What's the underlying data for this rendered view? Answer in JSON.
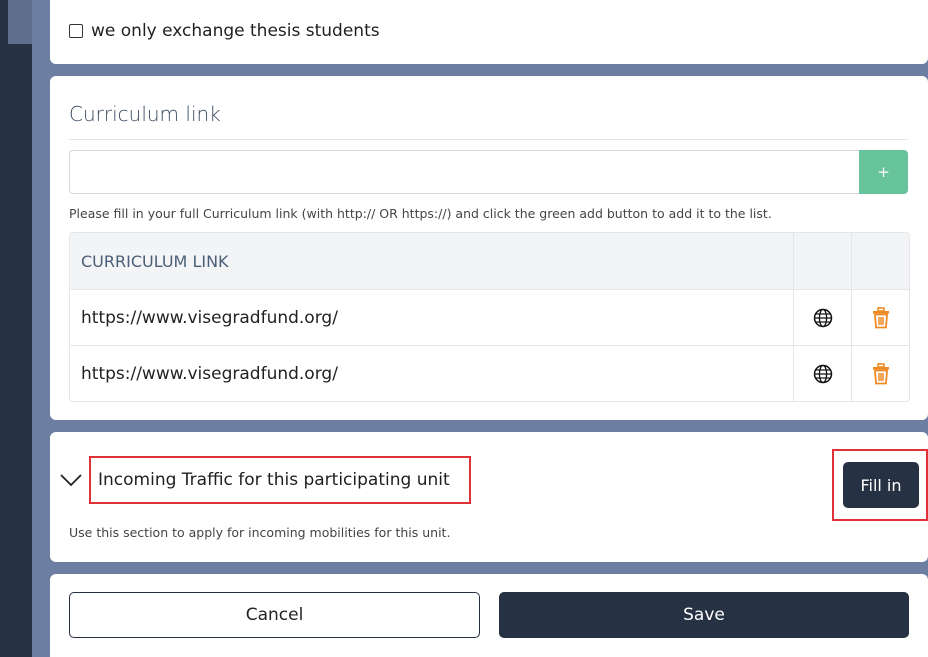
{
  "checkbox": {
    "label": "we only exchange thesis students",
    "checked": false
  },
  "curriculum": {
    "title": "Curriculum link",
    "input_value": "",
    "add_button_label": "+",
    "help_text": "Please fill in your full Curriculum link (with http:// OR https://) and click the green add button to add it to the list.",
    "table": {
      "column_header": "CURRICULUM LINK",
      "rows": [
        {
          "link": "https://www.visegradfund.org/"
        },
        {
          "link": "https://www.visegradfund.org/"
        }
      ]
    }
  },
  "incoming": {
    "title": "Incoming Traffic for this participating unit",
    "fill_in_label": "Fill in",
    "help_text": "Use this section to apply for incoming mobilities for this unit."
  },
  "actions": {
    "cancel_label": "Cancel",
    "save_label": "Save"
  },
  "colors": {
    "navy": "#263243",
    "green": "#66c39a",
    "trash_orange": "#f08a24",
    "highlight_red": "#e0303a",
    "background": "#6c7fa3"
  },
  "icons": {
    "globe": "globe-icon",
    "trash": "trash-icon",
    "chevron": "chevron-down-icon"
  }
}
